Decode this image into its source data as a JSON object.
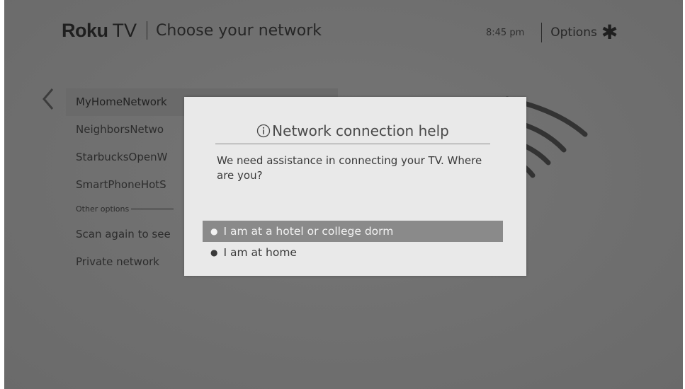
{
  "header": {
    "brand_roku": "Roku",
    "brand_tv": "TV",
    "title": "Choose your network",
    "clock": "8:45 pm",
    "options_label": "Options"
  },
  "icons": {
    "back": "chevron-left-icon",
    "options": "asterisk-icon",
    "wifi": "wifi-icon",
    "info": "info-icon"
  },
  "networks": {
    "items": [
      {
        "label": "MyHomeNetwork"
      },
      {
        "label": "NeighborsNetwo"
      },
      {
        "label": "StarbucksOpenW"
      },
      {
        "label": "SmartPhoneHotS"
      }
    ],
    "other_options_label": "Other options",
    "extra": [
      {
        "label": "Scan again to see"
      },
      {
        "label": "Private network"
      }
    ]
  },
  "dialog": {
    "title": "Network connection help",
    "message": "We need assistance in connecting your TV. Where are you?",
    "options": [
      {
        "label": "I am at a hotel or college dorm",
        "selected": true
      },
      {
        "label": "I am at home",
        "selected": false
      }
    ]
  },
  "colors": {
    "background": "#707070",
    "dialog": "#e9e9e9",
    "selected_option": "#8a8a8a"
  }
}
